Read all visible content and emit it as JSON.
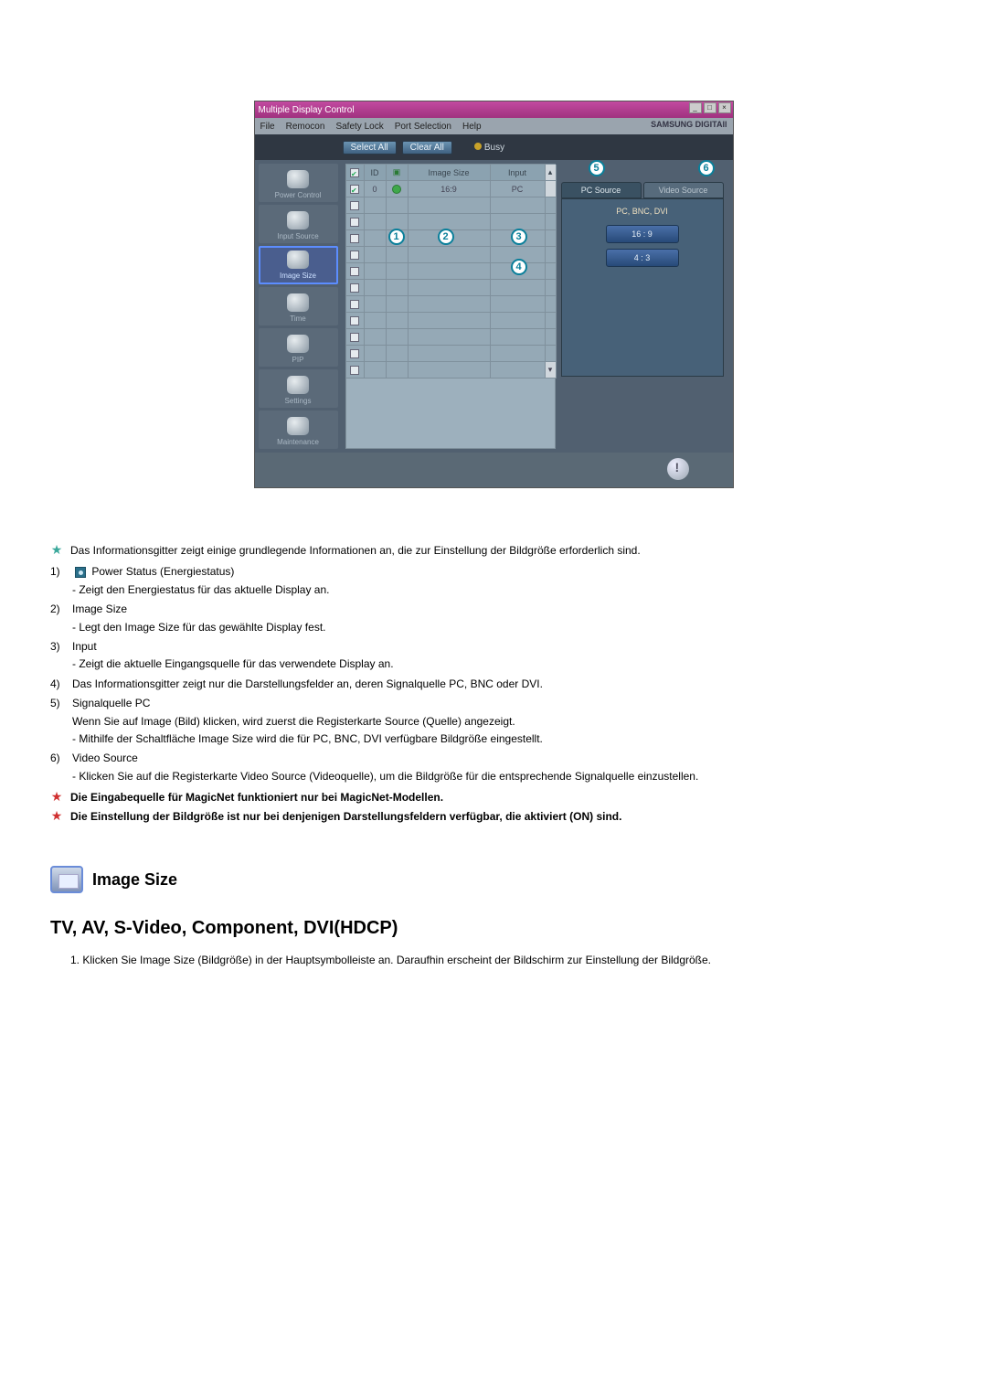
{
  "app": {
    "title": "Multiple Display Control",
    "sys_min": "_",
    "sys_max": "□",
    "sys_close": "×",
    "menu": {
      "file": "File",
      "remocon": "Remocon",
      "safety": "Safety Lock",
      "port": "Port Selection",
      "help": "Help"
    },
    "brand": "SAMSUNG DIGITAll",
    "select_all": "Select All",
    "clear_all": "Clear All",
    "busy": "Busy"
  },
  "sidebar": {
    "power": "Power Control",
    "input": "Input Source",
    "image": "Image Size",
    "time": "Time",
    "pip": "PIP",
    "settings": "Settings",
    "maint": "Maintenance"
  },
  "grid": {
    "hdr_id": "ID",
    "hdr_pwr": "",
    "hdr_imgsize": "Image Size",
    "hdr_input": "Input",
    "row_id": "0",
    "row_imgsize": "16:9",
    "row_input": "PC"
  },
  "callouts": {
    "c1": "1",
    "c2": "2",
    "c3": "3",
    "c4": "4",
    "c5": "5",
    "c6": "6"
  },
  "right": {
    "tab_pc": "PC Source",
    "tab_video": "Video Source",
    "lbl": "PC, BNC, DVI",
    "btn_169": "16 : 9",
    "btn_43": "4 : 3"
  },
  "doc": {
    "intro": "Das Informationsgitter zeigt einige grundlegende Informationen an, die zur Einstellung der Bildgröße erforderlich sind.",
    "n1": "1)",
    "n1_text": "Power Status (Energiestatus)",
    "n1_sub": "- Zeigt den Energiestatus für das aktuelle Display an.",
    "n2": "2)",
    "n2_text": "Image Size",
    "n2_sub": "- Legt den Image Size für das gewählte Display fest.",
    "n3": "3)",
    "n3_text": "Input",
    "n3_sub": "- Zeigt die aktuelle Eingangsquelle für das verwendete Display an.",
    "n4": "4)",
    "n4_text": "Das Informationsgitter zeigt nur die Darstellungsfelder an, deren Signalquelle PC, BNC oder DVI.",
    "n5": "5)",
    "n5_text": "Signalquelle PC",
    "n5_sub1": "Wenn Sie auf Image (Bild) klicken, wird zuerst die Registerkarte Source (Quelle) angezeigt.",
    "n5_sub2": "- Mithilfe der Schaltfläche Image Size wird die für PC, BNC, DVI verfügbare Bildgröße eingestellt.",
    "n6": "6)",
    "n6_text": "Video Source",
    "n6_sub": "- Klicken Sie auf die Registerkarte Video Source (Videoquelle), um die Bildgröße für die entsprechende Signalquelle einzustellen.",
    "note1": "Die Eingabequelle für MagicNet funktioniert nur bei MagicNet-Modellen.",
    "note2": "Die Einstellung der Bildgröße ist nur bei denjenigen Darstellungsfeldern verfügbar, die aktiviert (ON) sind.",
    "section_title": "Image Size",
    "big_sub": "TV, AV, S-Video, Component, DVI(HDCP)",
    "sub1_num": "1.",
    "sub1": "Klicken Sie Image Size (Bildgröße) in der Hauptsymbolleiste an. Daraufhin erscheint der Bildschirm zur Einstellung der Bildgröße."
  }
}
